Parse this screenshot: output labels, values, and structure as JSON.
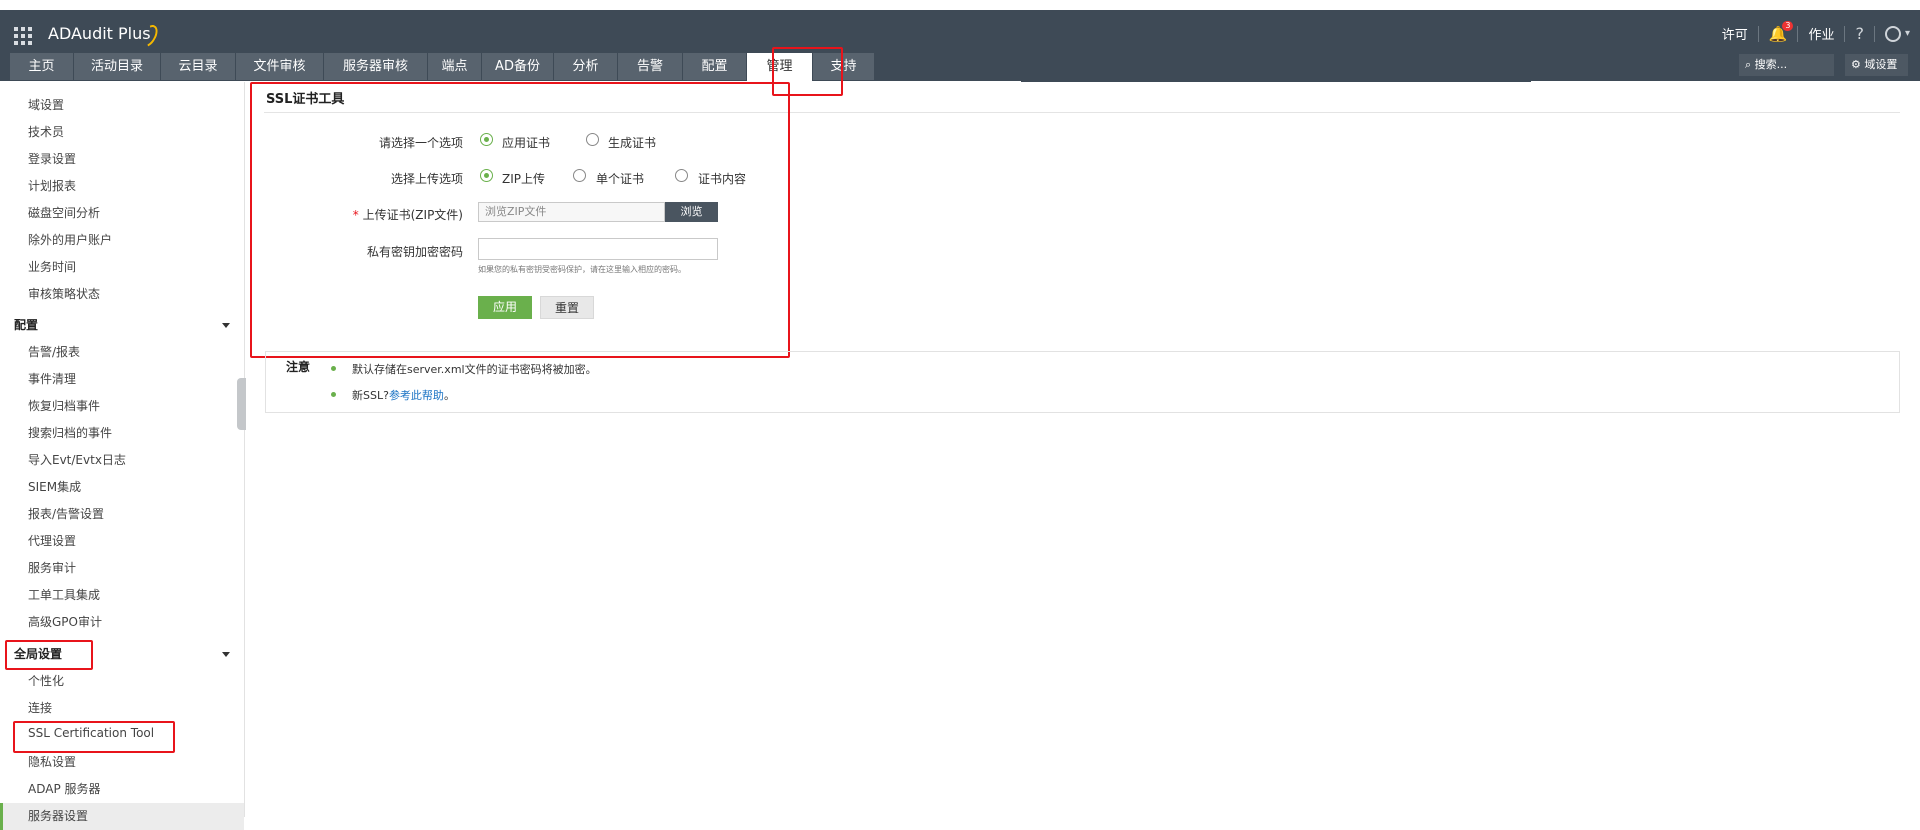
{
  "app": {
    "brand": "ADAudit Plus"
  },
  "header_right": {
    "license": "许可",
    "notifications_count": "3",
    "jobs": "作业",
    "help": "?",
    "user_caret": "▾"
  },
  "tabs": [
    {
      "label": "主页"
    },
    {
      "label": "活动目录"
    },
    {
      "label": "云目录"
    },
    {
      "label": "文件审核"
    },
    {
      "label": "服务器审核"
    },
    {
      "label": "端点"
    },
    {
      "label": "AD备份"
    },
    {
      "label": "分析"
    },
    {
      "label": "告警"
    },
    {
      "label": "配置"
    },
    {
      "label": "管理"
    },
    {
      "label": "支持"
    }
  ],
  "search": {
    "placeholder": "搜索..."
  },
  "domain_settings": "域设置",
  "sidebar": {
    "group1_items": [
      {
        "label": "域设置"
      },
      {
        "label": "技术员"
      },
      {
        "label": "登录设置"
      },
      {
        "label": "计划报表"
      },
      {
        "label": "磁盘空间分析"
      },
      {
        "label": "除外的用户账户"
      },
      {
        "label": "业务时间"
      },
      {
        "label": "审核策略状态"
      }
    ],
    "config_header": "配置",
    "config_items": [
      {
        "label": "告警/报表"
      },
      {
        "label": "事件清理"
      },
      {
        "label": "恢复归档事件"
      },
      {
        "label": "搜索归档的事件"
      },
      {
        "label": "导入Evt/Evtx日志"
      },
      {
        "label": "SIEM集成"
      },
      {
        "label": "报表/告警设置"
      },
      {
        "label": "代理设置"
      },
      {
        "label": "服务审计"
      },
      {
        "label": "工单工具集成"
      },
      {
        "label": "高级GPO审计"
      }
    ],
    "global_header": "全局设置",
    "global_items": [
      {
        "label": "个性化"
      },
      {
        "label": "连接"
      },
      {
        "label": "SSL Certification Tool"
      },
      {
        "label": "隐私设置"
      },
      {
        "label": "ADAP 服务器"
      },
      {
        "label": "服务器设置"
      }
    ]
  },
  "main": {
    "title": "SSL证书工具",
    "option_label": "请选择一个选项",
    "option_apply": "应用证书",
    "option_generate": "生成证书",
    "upload_option_label": "选择上传选项",
    "upload_zip": "ZIP上传",
    "upload_single": "单个证书",
    "upload_content": "证书内容",
    "required_mark": "*",
    "upload_label": "上传证书(ZIP文件)",
    "file_placeholder": "浏览ZIP文件",
    "browse": "浏览",
    "pwd_label": "私有密钥加密密码",
    "pwd_hint": "如果您的私有密钥受密码保护，请在这里输入相应的密码。",
    "apply": "应用",
    "reset": "重置"
  },
  "note": {
    "title": "注意",
    "line1": "默认存储在server.xml文件的证书密码将被加密。",
    "line2_prefix": "新SSL?",
    "line2_link": "参考此帮助",
    "line2_suffix": "。"
  },
  "colors": {
    "header": "#3e4a56",
    "accent": "#6ab04c",
    "highlight": "#e8141b",
    "link": "#1a73c4"
  }
}
